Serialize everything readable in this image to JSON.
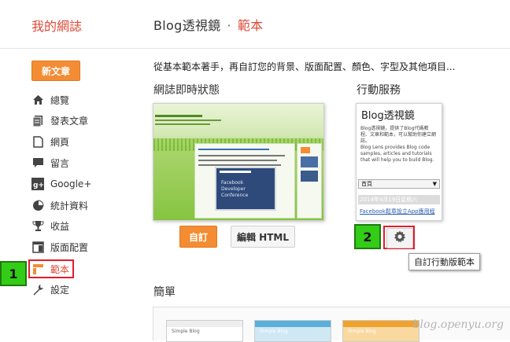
{
  "header": {
    "brand": "我的網誌",
    "blog_name": "Blog透視鏡",
    "separator": "·",
    "section": "範本"
  },
  "sidebar": {
    "new_post": "新文章",
    "items": [
      {
        "label": "總覽",
        "icon": "home-icon"
      },
      {
        "label": "發表文章",
        "icon": "posts-icon"
      },
      {
        "label": "網頁",
        "icon": "pages-icon"
      },
      {
        "label": "留言",
        "icon": "comment-icon"
      },
      {
        "label": "Google+",
        "icon": "google-plus-icon"
      },
      {
        "label": "統計資料",
        "icon": "stats-pie-icon"
      },
      {
        "label": "收益",
        "icon": "trophy-icon"
      },
      {
        "label": "版面配置",
        "icon": "layout-icon"
      },
      {
        "label": "範本",
        "icon": "template-icon",
        "active": true
      },
      {
        "label": "設定",
        "icon": "wrench-icon"
      }
    ]
  },
  "annotations": {
    "badge1": "1",
    "badge2": "2"
  },
  "main": {
    "intro": "從基本範本著手，再自訂您的背景、版面配置、顏色、字型及其他項目...",
    "live_title": "網誌即時狀態",
    "mobile_title": "行動服務",
    "customize_button": "自訂",
    "edit_html_button": "編輯 HTML",
    "gear_tooltip": "自訂行動版範本",
    "simple_title": "簡單"
  },
  "desktop_preview": {
    "fb_title": "Facebook",
    "fb_subtitle": "Developer Conference"
  },
  "mobile_preview": {
    "title": "Blog透視鏡",
    "desc": "Blog透視鏡，提供了Blog代碼教程、文章和範本，可以幫助你建立網誌。",
    "desc_en": "Blog Lens provides Blog code samples, articles and tutorials that will help you to build Blog.",
    "select": "首頁",
    "date": "2014年4月19日星期六",
    "post_link": "Facebook鬆章設立App應用程"
  },
  "simple_thumbs": [
    "Simple Blog",
    "Simple Blog",
    "Simple Blog"
  ],
  "watermark": "blog.openyu.org",
  "colors": {
    "accent": "#dd4b39",
    "orange_button": "#f48c33",
    "highlight_red": "#e21c2c",
    "badge_green": "#33cc17"
  }
}
